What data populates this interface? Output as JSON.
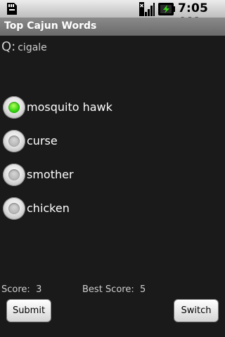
{
  "status_bar": {
    "time": "7:05 AM",
    "icons": [
      "sd-card-icon",
      "signal-icon",
      "battery-icon"
    ]
  },
  "title_bar": {
    "title": "Top Cajun Words"
  },
  "question": {
    "prefix": "Q:",
    "word": "cigale"
  },
  "options": [
    {
      "label": "mosquito hawk",
      "selected": true
    },
    {
      "label": "curse",
      "selected": false
    },
    {
      "label": "smother",
      "selected": false
    },
    {
      "label": "chicken",
      "selected": false
    }
  ],
  "scores": {
    "score_label": "Score:",
    "score_value": "3",
    "best_label": "Best Score:",
    "best_value": "5"
  },
  "buttons": {
    "submit": "Submit",
    "switch": "Switch"
  },
  "colors": {
    "selected_radio": "#36d611",
    "title_bar": "#7a7a7a"
  }
}
